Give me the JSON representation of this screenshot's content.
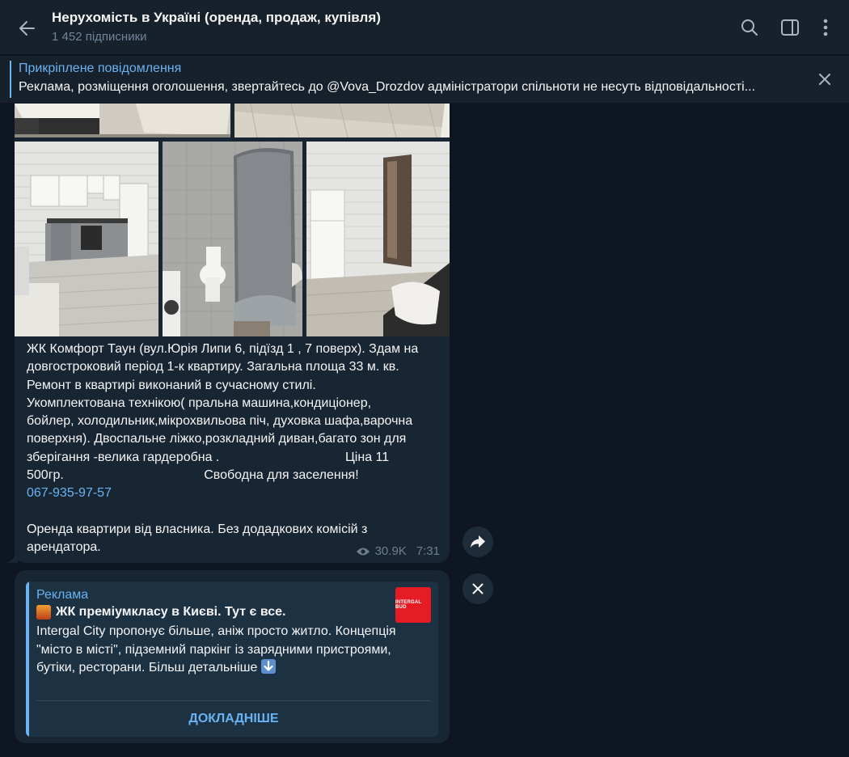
{
  "header": {
    "title": "Нерухомість в Україні (оренда, продаж, купівля)",
    "subscribers": "1 452 підписники"
  },
  "pinned": {
    "title": "Прикріплене повідомлення",
    "text": "Реклама, розміщення оголошення, звертайтесь до @Vova_Drozdov адміністратори спільноти не несуть відповідальності..."
  },
  "message": {
    "text_before_phone": "ЖК Комфорт Таун (вул.Юрія Липи 6, підїзд 1 , 7 поверх). Здам на\nдовгостроковий період 1-к квартиру. Загальна площа 33 м. кв.\nРемонт в квартирі виконаний в сучасному стилі.\nУкомплектована технікою( пральна машина,кондиціонер,\nбойлер, холодильник,мікрохвильова піч, духовка шафа,варочна\nповерхня). Двоспальне ліжко,розкладний диван,багато зон для\nзберігання -велика гардеробна .                                   Ціна 11\n500гр.                                       Свободна для заселення!\n",
    "phone": "067-935-97-57",
    "text_after_phone": "\n\nОренда квартири від власника. Без додадкових комісій з\nарендатора.",
    "views": "30.9K",
    "time": "7:31"
  },
  "ad": {
    "label": "Реклама",
    "title": "ЖК преміумкласу в Києві. Тут є все.",
    "body": "Intergal City пропонує більше, аніж просто житло. Концепція \"місто в місті\", підземний паркінг із зарядними пристроями, бутіки, ресторани. Більш детальніше",
    "logo_text": "INTERGAL BUD",
    "button": "ДОКЛАДНІШЕ"
  },
  "colors": {
    "accent": "#6ab2f2",
    "bubble": "#182533",
    "background": "#0e1621",
    "header": "#17212b",
    "logo_red": "#e51c23"
  }
}
